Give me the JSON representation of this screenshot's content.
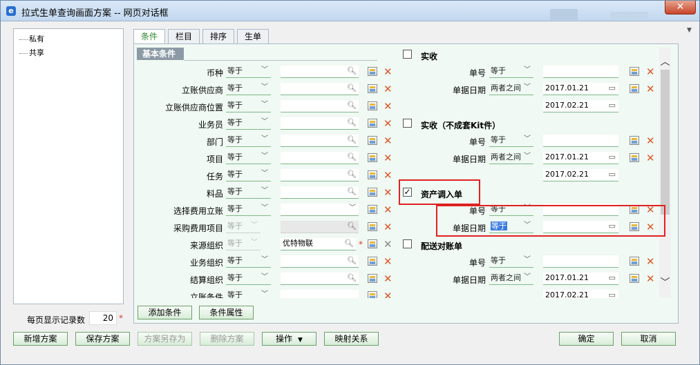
{
  "window": {
    "title": "拉式生单查询画面方案 -- 网页对话框",
    "close": "✕"
  },
  "tree": {
    "items": [
      "私有",
      "共享"
    ]
  },
  "records": {
    "label": "每页显示记录数",
    "value": "20",
    "required": "*"
  },
  "tabs": [
    "条件",
    "栏目",
    "排序",
    "生单"
  ],
  "section": {
    "title": "基本条件"
  },
  "op_label": "等于",
  "op_between": "两者之间",
  "left_rows": [
    {
      "label": "币种",
      "op": "等于",
      "value": ""
    },
    {
      "label": "立账供应商",
      "op": "等于",
      "value": ""
    },
    {
      "label": "立账供应商位置",
      "op": "等于",
      "value": ""
    },
    {
      "label": "业务员",
      "op": "等于",
      "value": ""
    },
    {
      "label": "部门",
      "op": "等于",
      "value": ""
    },
    {
      "label": "项目",
      "op": "等于",
      "value": ""
    },
    {
      "label": "任务",
      "op": "等于",
      "value": ""
    },
    {
      "label": "料品",
      "op": "等于",
      "value": ""
    },
    {
      "label": "选择费用立账",
      "op": "等于",
      "value": ""
    },
    {
      "label": "采购费用项目",
      "op": "等于",
      "value": ""
    },
    {
      "label": "来源组织",
      "op": "等于",
      "value": "优特物联",
      "required": "*"
    },
    {
      "label": "业务组织",
      "op": "等于",
      "value": ""
    },
    {
      "label": "结算组织",
      "op": "等于",
      "value": ""
    },
    {
      "label": "立账条件",
      "op": "等于",
      "value": ""
    }
  ],
  "groups": [
    {
      "title": "实收",
      "checked": "",
      "no_label": "单号",
      "no_op": "等于",
      "date_label": "单据日期",
      "date_op": "两者之间",
      "date_from": "2017.01.21",
      "date_to": "2017.02.21"
    },
    {
      "title": "实收（不成套Kit件）",
      "checked": "",
      "no_label": "单号",
      "no_op": "等于",
      "date_label": "单据日期",
      "date_op": "两者之间",
      "date_from": "2017.01.21",
      "date_to": "2017.02.21"
    },
    {
      "title": "资产调入单",
      "checked": "✓",
      "no_label": "单号",
      "no_op": "等于",
      "date_label": "单据日期",
      "date_op": "等于",
      "date_from": ""
    },
    {
      "title": "配送对账单",
      "checked": "",
      "no_label": "单号",
      "no_op": "等于",
      "date_label": "单据日期",
      "date_op": "两者之间",
      "date_from": "2017.01.21",
      "date_to": "2017.02.21"
    }
  ],
  "buttons": {
    "add_condition": "添加条件",
    "condition_props": "条件属性",
    "new_scheme": "新增方案",
    "save_scheme": "保存方案",
    "save_as": "方案另存为",
    "delete_scheme": "删除方案",
    "operate": "操作",
    "mapping": "映射关系",
    "ok": "确定",
    "cancel": "取消"
  },
  "icons": {
    "search": "search-icon",
    "calendar": "calendar-icon",
    "delete": "delete-x-icon",
    "picker": "reference-picker-icon"
  },
  "colors": {
    "accent_green": "#2c8a2c",
    "delete_orange": "#e0562a",
    "highlight_red": "#e02020",
    "selection_blue": "#3b7ce0"
  }
}
